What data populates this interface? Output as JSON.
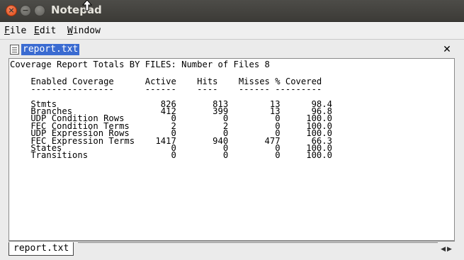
{
  "window": {
    "title": "Notepad"
  },
  "menu": {
    "items": [
      {
        "label": "File"
      },
      {
        "label": "Edit"
      },
      {
        "label": "Window"
      }
    ]
  },
  "document": {
    "name": "report.txt",
    "heading": "Coverage Report Totals BY FILES: Number of Files 8",
    "table": {
      "headers": [
        "Enabled Coverage",
        "Active",
        "Hits",
        "Misses",
        "% Covered"
      ],
      "rows": [
        {
          "name": "Stmts",
          "active": "826",
          "hits": "813",
          "misses": "13",
          "covered": "98.4"
        },
        {
          "name": "Branches",
          "active": "412",
          "hits": "399",
          "misses": "13",
          "covered": "96.8"
        },
        {
          "name": "UDP Condition Rows",
          "active": "0",
          "hits": "0",
          "misses": "0",
          "covered": "100.0"
        },
        {
          "name": "FEC Condition Terms",
          "active": "2",
          "hits": "2",
          "misses": "0",
          "covered": "100.0"
        },
        {
          "name": "UDP Expression Rows",
          "active": "0",
          "hits": "0",
          "misses": "0",
          "covered": "100.0"
        },
        {
          "name": "FEC Expression Terms",
          "active": "1417",
          "hits": "940",
          "misses": "477",
          "covered": "66.3"
        },
        {
          "name": "States",
          "active": "0",
          "hits": "0",
          "misses": "0",
          "covered": "100.0"
        },
        {
          "name": "Transitions",
          "active": "0",
          "hits": "0",
          "misses": "0",
          "covered": "100.0"
        }
      ]
    }
  },
  "tabs": [
    {
      "label": "report.txt"
    }
  ],
  "colors": {
    "titlebar": "#3c3b37",
    "selection": "#3a6bd1",
    "close_button": "#df4b16"
  }
}
